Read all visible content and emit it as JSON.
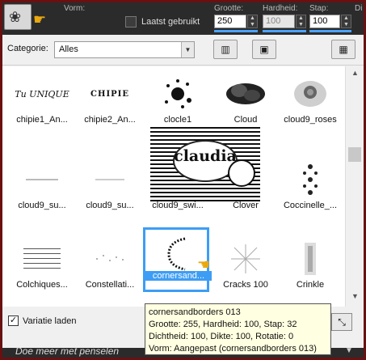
{
  "toolbar": {
    "labels": [
      "Vorm:",
      "Grootte:",
      "Hardheid:",
      "Stap:",
      "Di"
    ],
    "last_used_label": "Laatst gebruikt",
    "size_value": "250",
    "hardness_value": "100",
    "step_value": "100"
  },
  "category": {
    "label": "Categorie:",
    "selected": "Alles"
  },
  "presets": [
    {
      "caption": "chipie1_An...",
      "thumb_text": "Tu UNIQUE"
    },
    {
      "caption": "chipie2_An...",
      "thumb_text": "CHIPIE"
    },
    {
      "caption": "clocle1",
      "thumb_text": ""
    },
    {
      "caption": "Cloud",
      "thumb_text": ""
    },
    {
      "caption": "cloud9_roses",
      "thumb_text": ""
    },
    {
      "caption": "cloud9_su...",
      "thumb_text": ""
    },
    {
      "caption": "cloud9_su...",
      "thumb_text": ""
    },
    {
      "caption": "cloud9_swi...",
      "thumb_text": ""
    },
    {
      "caption": "Clover",
      "thumb_text": ""
    },
    {
      "caption": "Coccinelle_...",
      "thumb_text": ""
    },
    {
      "caption": "Colchiques...",
      "thumb_text": ""
    },
    {
      "caption": "Constellati...",
      "thumb_text": ""
    },
    {
      "caption": "cornersand...",
      "thumb_text": ""
    },
    {
      "caption": "Cracks 100",
      "thumb_text": ""
    },
    {
      "caption": "Crinkle",
      "thumb_text": ""
    }
  ],
  "watermark_text": "claudia",
  "bottom": {
    "variation_label": "Variatie laden",
    "more_label": "Doe meer met penselen"
  },
  "tooltip": {
    "line1": "cornersandborders 013",
    "line2": "Grootte: 255, Hardheid: 100, Stap: 32",
    "line3": "Dichtheid: 100, Dikte: 100, Rotatie: 0",
    "line4": "Vorm: Aangepast (cornersandborders 013)"
  },
  "colors": {
    "accent": "#3d9df5",
    "frame": "#6b1010",
    "pointer": "#e9a80f"
  },
  "icons": [
    "preset-picker-icon",
    "pointing-hand-icon",
    "save-preset-icon",
    "delete-preset-icon",
    "manage-presets-icon",
    "reset-icon",
    "scroll-up-icon",
    "scroll-down-icon"
  ]
}
